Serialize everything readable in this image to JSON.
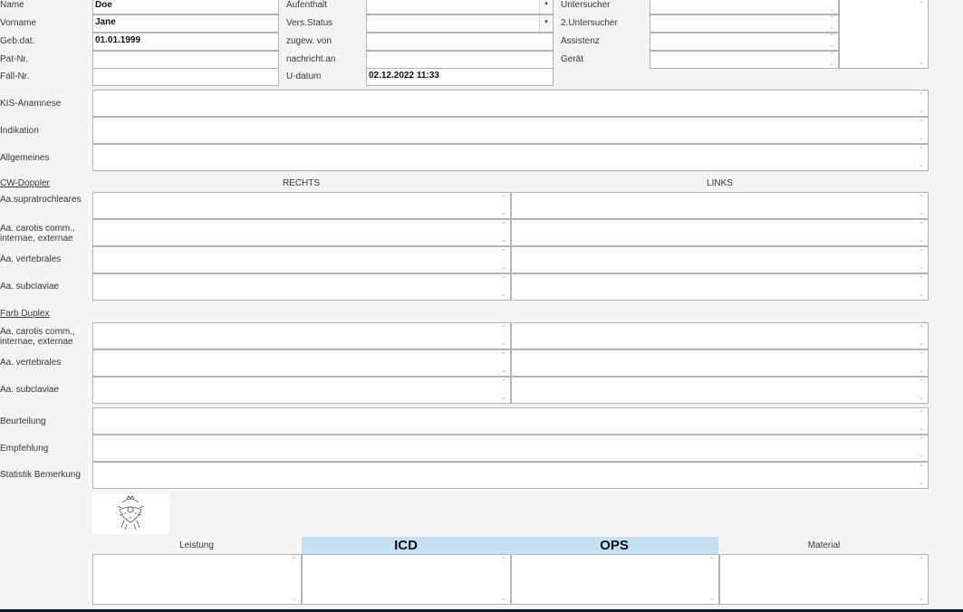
{
  "patient": {
    "name_label": "Name",
    "name_value": "Doe",
    "vorname_label": "Vorname",
    "vorname_value": "Jane",
    "gebdat_label": "Geb.dat.",
    "gebdat_value": "01.01.1999",
    "patnr_label": "Pat-Nr.",
    "fallnr_label": "Fall-Nr."
  },
  "stay": {
    "aufenthalt_label": "Aufenthalt",
    "versstatus_label": "Vers.Status",
    "zugewvon_label": "zugew. von",
    "nachrichtan_label": "nachricht.an",
    "udatum_label": "U-datum",
    "udatum_value": "02.12.2022 11:33"
  },
  "staff": {
    "untersucher_label": "Untersucher",
    "untersucher2_label": "2.Untersucher",
    "assistenz_label": "Assistenz",
    "geraet_label": "Gerät"
  },
  "general": {
    "kis_label": "KIS-Anamnese",
    "indikation_label": "Indikation",
    "allgemeines_label": "Allgemeines"
  },
  "cw": {
    "section_label": "CW-Doppler",
    "rechts_header": "RECHTS",
    "links_header": "LINKS",
    "rows": [
      "Aa.supratrochleares",
      "Aa. carotis comm., internae, externae",
      "Aa. vertebrales",
      "Aa. subclaviae"
    ]
  },
  "duplex": {
    "section_label": "Farb Duplex",
    "rows": [
      "Aa. carotis comm., internae, externae",
      "Aa. vertebrales",
      "Aa. subclaviae"
    ]
  },
  "assessment": {
    "beurteilung_label": "Beurteilung",
    "empfehlung_label": "Empfehlung",
    "statistik_label": "Statistik Bemerkung"
  },
  "billing": {
    "leistung_header": "Leistung",
    "icd_header": "ICD",
    "ops_header": "OPS",
    "material_header": "Material"
  },
  "icons": {
    "dropdown": "▾",
    "scroll_up": "⌃",
    "scroll_down": "⌄",
    "logo": "seal-logo"
  },
  "colors": {
    "accent_bar": "#c4e1f3",
    "window_frame": "#0f1d2e"
  }
}
